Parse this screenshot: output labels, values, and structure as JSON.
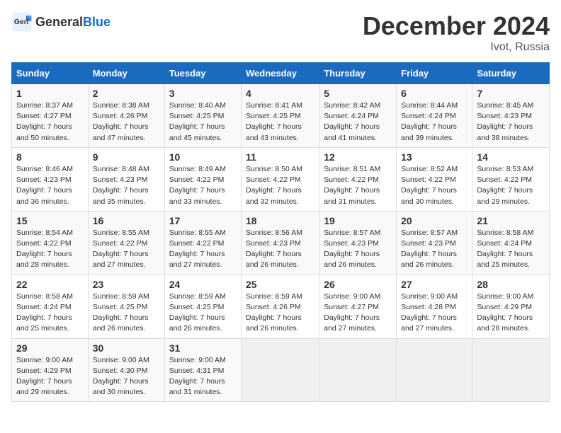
{
  "header": {
    "logo_general": "General",
    "logo_blue": "Blue",
    "title": "December 2024",
    "location": "Ivot, Russia"
  },
  "weekdays": [
    "Sunday",
    "Monday",
    "Tuesday",
    "Wednesday",
    "Thursday",
    "Friday",
    "Saturday"
  ],
  "weeks": [
    [
      {
        "day": "1",
        "sunrise": "8:37 AM",
        "sunset": "4:27 PM",
        "daylight": "7 hours and 50 minutes."
      },
      {
        "day": "2",
        "sunrise": "8:38 AM",
        "sunset": "4:26 PM",
        "daylight": "7 hours and 47 minutes."
      },
      {
        "day": "3",
        "sunrise": "8:40 AM",
        "sunset": "4:25 PM",
        "daylight": "7 hours and 45 minutes."
      },
      {
        "day": "4",
        "sunrise": "8:41 AM",
        "sunset": "4:25 PM",
        "daylight": "7 hours and 43 minutes."
      },
      {
        "day": "5",
        "sunrise": "8:42 AM",
        "sunset": "4:24 PM",
        "daylight": "7 hours and 41 minutes."
      },
      {
        "day": "6",
        "sunrise": "8:44 AM",
        "sunset": "4:24 PM",
        "daylight": "7 hours and 39 minutes."
      },
      {
        "day": "7",
        "sunrise": "8:45 AM",
        "sunset": "4:23 PM",
        "daylight": "7 hours and 38 minutes."
      }
    ],
    [
      {
        "day": "8",
        "sunrise": "8:46 AM",
        "sunset": "4:23 PM",
        "daylight": "7 hours and 36 minutes."
      },
      {
        "day": "9",
        "sunrise": "8:48 AM",
        "sunset": "4:23 PM",
        "daylight": "7 hours and 35 minutes."
      },
      {
        "day": "10",
        "sunrise": "8:49 AM",
        "sunset": "4:22 PM",
        "daylight": "7 hours and 33 minutes."
      },
      {
        "day": "11",
        "sunrise": "8:50 AM",
        "sunset": "4:22 PM",
        "daylight": "7 hours and 32 minutes."
      },
      {
        "day": "12",
        "sunrise": "8:51 AM",
        "sunset": "4:22 PM",
        "daylight": "7 hours and 31 minutes."
      },
      {
        "day": "13",
        "sunrise": "8:52 AM",
        "sunset": "4:22 PM",
        "daylight": "7 hours and 30 minutes."
      },
      {
        "day": "14",
        "sunrise": "8:53 AM",
        "sunset": "4:22 PM",
        "daylight": "7 hours and 29 minutes."
      }
    ],
    [
      {
        "day": "15",
        "sunrise": "8:54 AM",
        "sunset": "4:22 PM",
        "daylight": "7 hours and 28 minutes."
      },
      {
        "day": "16",
        "sunrise": "8:55 AM",
        "sunset": "4:22 PM",
        "daylight": "7 hours and 27 minutes."
      },
      {
        "day": "17",
        "sunrise": "8:55 AM",
        "sunset": "4:22 PM",
        "daylight": "7 hours and 27 minutes."
      },
      {
        "day": "18",
        "sunrise": "8:56 AM",
        "sunset": "4:23 PM",
        "daylight": "7 hours and 26 minutes."
      },
      {
        "day": "19",
        "sunrise": "8:57 AM",
        "sunset": "4:23 PM",
        "daylight": "7 hours and 26 minutes."
      },
      {
        "day": "20",
        "sunrise": "8:57 AM",
        "sunset": "4:23 PM",
        "daylight": "7 hours and 26 minutes."
      },
      {
        "day": "21",
        "sunrise": "8:58 AM",
        "sunset": "4:24 PM",
        "daylight": "7 hours and 25 minutes."
      }
    ],
    [
      {
        "day": "22",
        "sunrise": "8:58 AM",
        "sunset": "4:24 PM",
        "daylight": "7 hours and 25 minutes."
      },
      {
        "day": "23",
        "sunrise": "8:59 AM",
        "sunset": "4:25 PM",
        "daylight": "7 hours and 26 minutes."
      },
      {
        "day": "24",
        "sunrise": "8:59 AM",
        "sunset": "4:25 PM",
        "daylight": "7 hours and 26 minutes."
      },
      {
        "day": "25",
        "sunrise": "8:59 AM",
        "sunset": "4:26 PM",
        "daylight": "7 hours and 26 minutes."
      },
      {
        "day": "26",
        "sunrise": "9:00 AM",
        "sunset": "4:27 PM",
        "daylight": "7 hours and 27 minutes."
      },
      {
        "day": "27",
        "sunrise": "9:00 AM",
        "sunset": "4:28 PM",
        "daylight": "7 hours and 27 minutes."
      },
      {
        "day": "28",
        "sunrise": "9:00 AM",
        "sunset": "4:29 PM",
        "daylight": "7 hours and 28 minutes."
      }
    ],
    [
      {
        "day": "29",
        "sunrise": "9:00 AM",
        "sunset": "4:29 PM",
        "daylight": "7 hours and 29 minutes."
      },
      {
        "day": "30",
        "sunrise": "9:00 AM",
        "sunset": "4:30 PM",
        "daylight": "7 hours and 30 minutes."
      },
      {
        "day": "31",
        "sunrise": "9:00 AM",
        "sunset": "4:31 PM",
        "daylight": "7 hours and 31 minutes."
      },
      null,
      null,
      null,
      null
    ]
  ]
}
